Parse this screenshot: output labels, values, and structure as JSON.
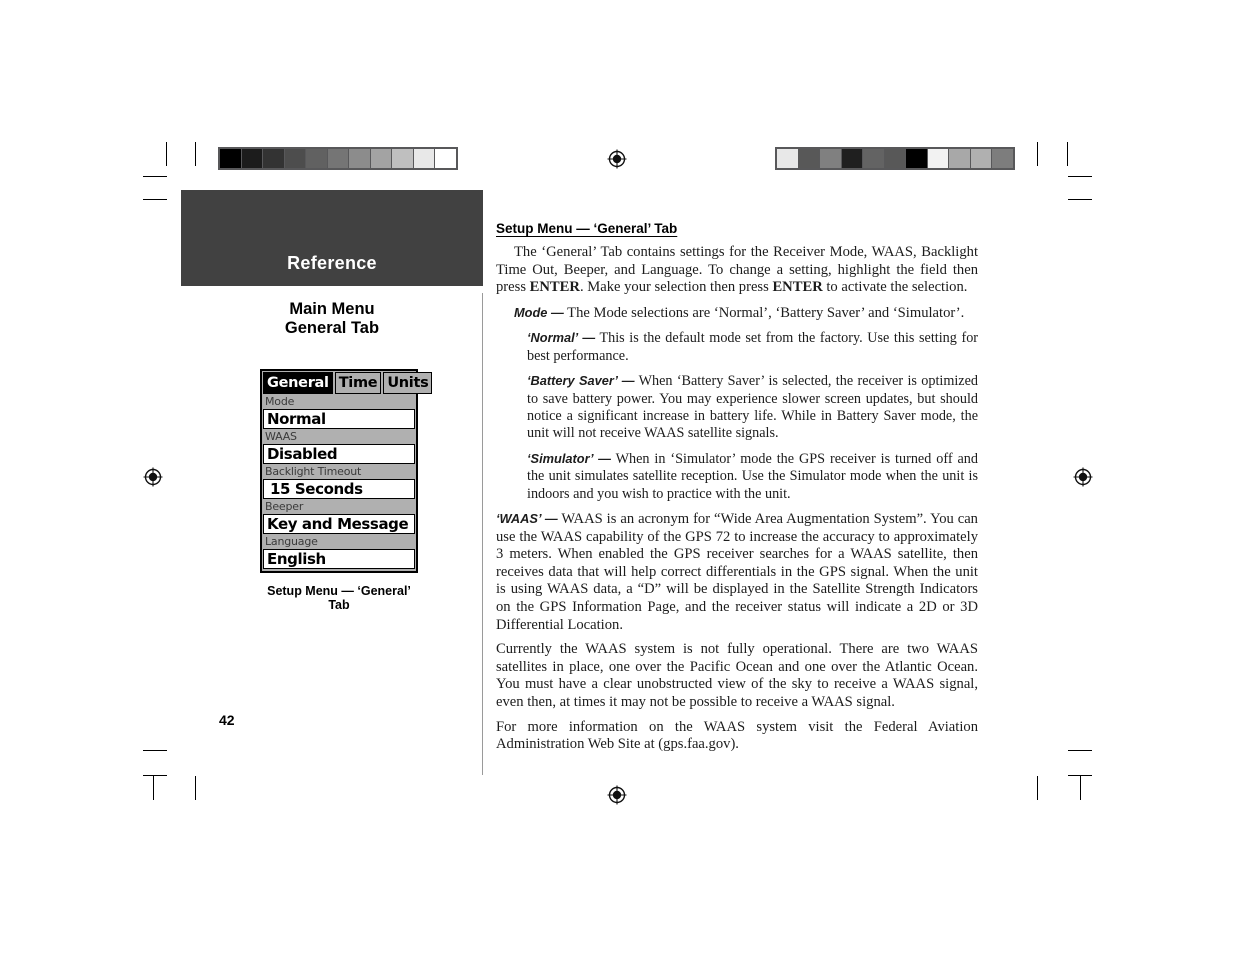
{
  "page": {
    "number": "42",
    "chapter": "Reference",
    "side_heading_line1": "Main Menu",
    "side_heading_line2": "General Tab",
    "divider_color": "#9a9a9a",
    "band_color": "#414141"
  },
  "figure": {
    "caption": "Setup Menu — ‘General’ Tab",
    "tabs": [
      {
        "label": "General",
        "selected": true
      },
      {
        "label": "Time",
        "selected": false
      },
      {
        "label": "Units",
        "selected": false
      }
    ],
    "fields": [
      {
        "label": "Mode",
        "value": "Normal",
        "indent": false
      },
      {
        "label": "WAAS",
        "value": "Disabled",
        "indent": false
      },
      {
        "label": "Backlight Timeout",
        "value": "15 Seconds",
        "indent": true
      },
      {
        "label": "Beeper",
        "value": "Key and Message",
        "indent": false
      },
      {
        "label": "Language",
        "value": "English",
        "indent": false
      }
    ]
  },
  "content": {
    "heading": "Setup Menu — ‘General’ Tab",
    "intro_a": "The ‘General’ Tab contains settings for the Receiver Mode, WAAS, Backlight Time Out, Beeper, and Language.  To change a setting, highlight the field then press ",
    "intro_enter1": "ENTER",
    "intro_b": ".  Make your selection then press ",
    "intro_enter2": "ENTER",
    "intro_c": " to activate the selection.",
    "mode_term": "Mode —",
    "mode_text": " The Mode selections are ‘Normal’, ‘Battery Saver’ and ‘Simulator’.",
    "normal_term": "‘Normal’ —",
    "normal_text": " This is the default mode set from the factory. Use this setting for best performance.",
    "battery_term": "‘Battery Saver’ —",
    "battery_text": " When ‘Battery Saver’ is selected, the receiver is optimized to save battery power.  You may experience slower screen updates, but should notice a significant increase in battery life.  While in Battery Saver mode, the unit will not receive WAAS satellite signals.",
    "simulator_term": "‘Simulator’ —",
    "simulator_text": " When in ‘Simulator’ mode the GPS receiver is turned off and the unit simulates satellite reception.  Use the Simulator mode when the unit is indoors and you wish to practice with the unit.",
    "waas_term": "‘WAAS’ —",
    "waas_text": " WAAS is an acronym for “Wide Area Augmentation System”. You can use the WAAS capability of the GPS 72 to increase the accuracy to approximately 3 meters. When enabled the GPS receiver searches for a WAAS satellite, then receives data that will help correct differentials in the GPS signal.  When the unit is using WAAS data, a “D” will be displayed in the Satellite Strength Indicators on the GPS Information Page, and the receiver status will indicate a 2D or 3D Differential Location.",
    "waas_status": "Currently the WAAS system is not fully operational. There are two WAAS satellites in place, one over the Pacific Ocean and one over the Atlantic Ocean.  You must have a clear unobstructed view of the sky to receive a WAAS signal, even then, at times it may not be possible to receive a WAAS signal.",
    "waas_more": "For more information on the WAAS system visit the Federal Aviation Administration Web Site at (gps.faa.gov)."
  },
  "calibration": {
    "left_strip": [
      "#000000",
      "#1c1c1c",
      "#333333",
      "#4d4d4d",
      "#616161",
      "#757575",
      "#8c8c8c",
      "#a3a3a3",
      "#bfbfbf",
      "#e8e8e8",
      "#ffffff"
    ],
    "right_strip": [
      "#e8e8e8",
      "#585858",
      "#808080",
      "#1f1f1f",
      "#636363",
      "#585858",
      "#000000",
      "#f2f2f2",
      "#a8a8a8",
      "#b0b0b0",
      "#7d7d7d"
    ]
  }
}
